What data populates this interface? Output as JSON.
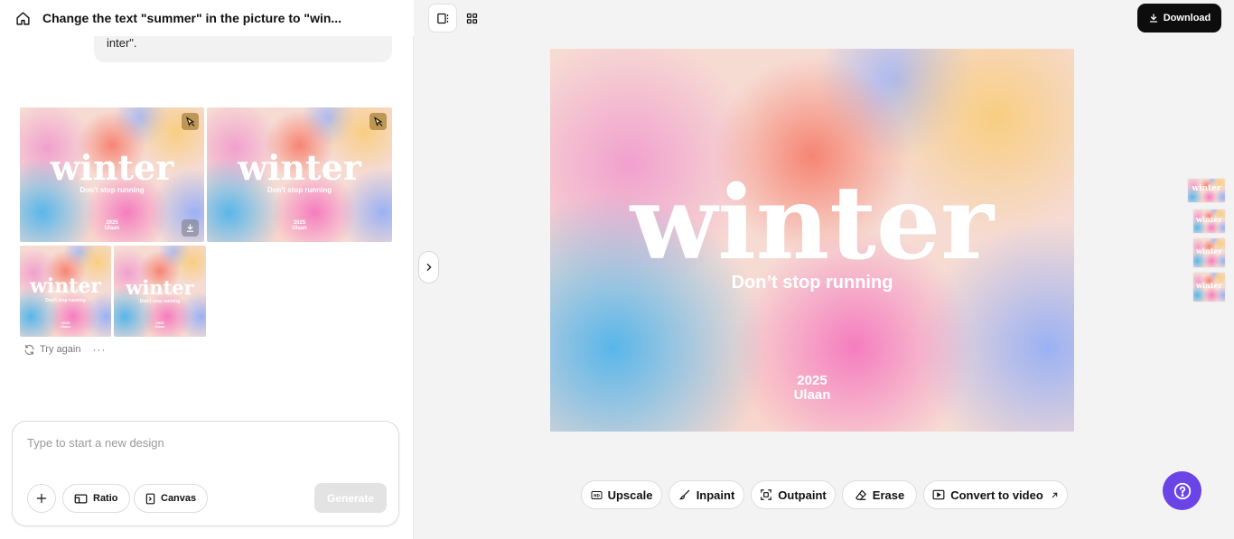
{
  "header": {
    "title": "Change the text \"summer\" in the picture to \"win..."
  },
  "chat": {
    "user_message_tail": "inter\".",
    "try_again_label": "Try again",
    "more_label": "···"
  },
  "thumb_design": {
    "word": "winter",
    "tagline": "Don't stop running",
    "year": "2025",
    "name": "Ulaan"
  },
  "composer": {
    "placeholder": "Type to start a new design",
    "ratio_label": "Ratio",
    "canvas_label": "Canvas",
    "generate_label": "Generate"
  },
  "toolbar": {
    "download_label": "Download"
  },
  "canvas": {
    "word": "winter",
    "tagline": "Don’t stop running",
    "year": "2025",
    "name": "Ulaan"
  },
  "tools": {
    "upscale": "Upscale",
    "inpaint": "Inpaint",
    "outpaint": "Outpaint",
    "erase": "Erase",
    "convert": "Convert to video"
  },
  "icons": {
    "home": "home-icon",
    "badge": "cursor-edit-icon",
    "download": "download-icon",
    "help": "help-icon"
  },
  "colors": {
    "accent": "#6a44e6",
    "download_bg": "#0d0d0d"
  }
}
